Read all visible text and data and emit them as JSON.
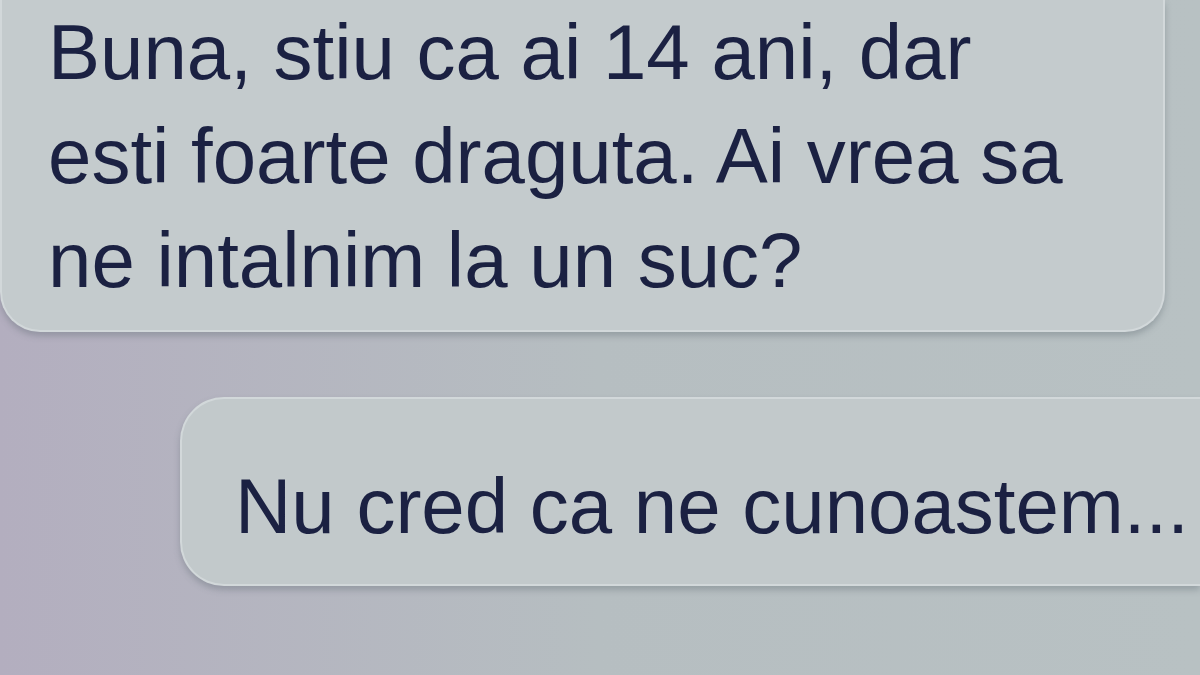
{
  "messages": [
    {
      "kind": "received",
      "text": "Buna, stiu ca ai 14 ani, dar esti foarte draguta. Ai vrea sa ne intalnim la un suc?"
    },
    {
      "kind": "sent",
      "text": "Nu cred ca ne cunoastem..."
    }
  ]
}
